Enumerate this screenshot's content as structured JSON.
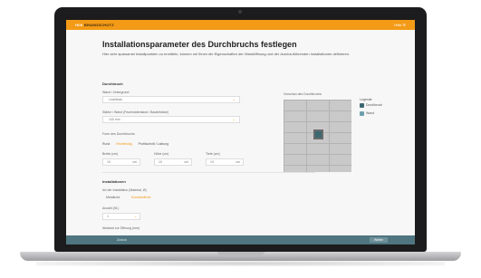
{
  "app": {
    "brand_primary": "Hilti",
    "brand_accent": "BRANDSCHUTZ",
    "top_right": "Hilfe   ☰"
  },
  "page": {
    "title": "Installationsparameter des Durchbruchs festlegen",
    "intro": "Hier sehr sparsamst Installpunkten zu ermitteln, können wir Ihnen die Eigenschaften der Wandöffnung und der durchzuführenden Installationen definieren."
  },
  "durchbruch": {
    "heading": "Durchbruch",
    "wall_type_label": "Wand / Untergrund",
    "wall_type_value": "Leichtbau",
    "thickness_label": "Stärke / Wand (Feuerwiderstand / Bauteildicke)",
    "thickness_value": "100 mm",
    "form_label": "Form des Durchbruchs",
    "form_options": [
      "Rund",
      "Rechteckig",
      "Profilschnitt / Laibung"
    ],
    "dims": [
      {
        "label": "Breite (cm)",
        "value": "10",
        "unit": "cm"
      },
      {
        "label": "Höhe (cm)",
        "value": "10",
        "unit": "cm"
      },
      {
        "label": "Tiefe (cm)",
        "value": "10",
        "unit": "cm"
      }
    ]
  },
  "preview": {
    "label": "Vorschau des Durchbruchs",
    "legend_title": "Legende",
    "legend": [
      {
        "label": "Durchbruch",
        "color": "#3c6872"
      },
      {
        "label": "Wand",
        "color": "#6e9fae"
      }
    ]
  },
  "installation": {
    "heading": "Installationen",
    "type_label": "Art der Installation (Material, Ø)",
    "type_options": [
      "Metallrohr",
      "Kunststoffrohr"
    ],
    "count_label": "Anzahl (St.)",
    "count_value": "1",
    "extra_label": "Abstand zur Öffnung (mm)"
  },
  "footer": {
    "back_label": "Zurück",
    "next_label": "Weiter"
  }
}
